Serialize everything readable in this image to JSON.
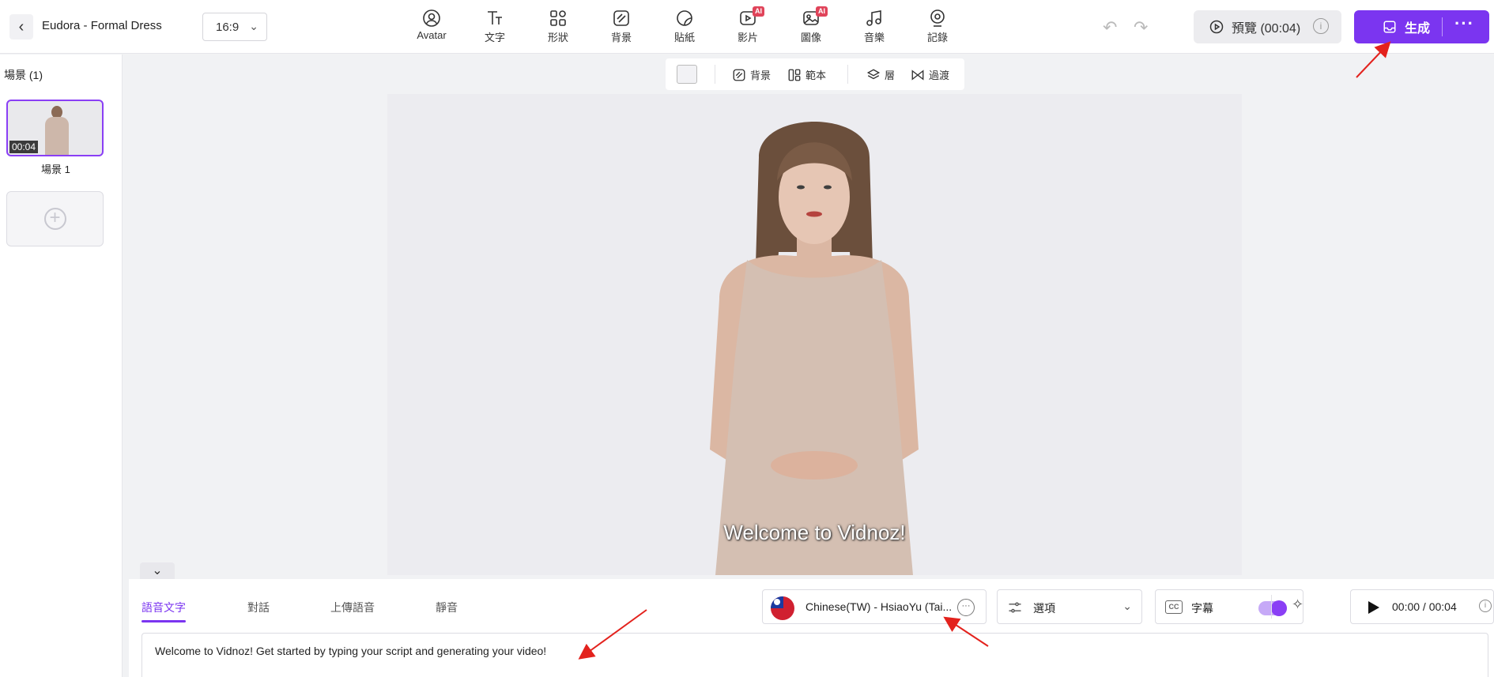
{
  "header": {
    "project_title": "Eudora - Formal Dress",
    "aspect_ratio": "16:9",
    "tools": [
      {
        "label": "Avatar",
        "icon": "avatar-icon",
        "ai": false
      },
      {
        "label": "文字",
        "icon": "text-icon",
        "ai": false
      },
      {
        "label": "形狀",
        "icon": "shapes-icon",
        "ai": false
      },
      {
        "label": "背景",
        "icon": "background-icon",
        "ai": false
      },
      {
        "label": "貼紙",
        "icon": "sticker-icon",
        "ai": false
      },
      {
        "label": "影片",
        "icon": "video-icon",
        "ai": true
      },
      {
        "label": "圖像",
        "icon": "image-icon",
        "ai": true
      },
      {
        "label": "音樂",
        "icon": "music-icon",
        "ai": false
      },
      {
        "label": "記錄",
        "icon": "record-icon",
        "ai": false
      }
    ],
    "ai_badge": "AI",
    "preview_label": "預覽 (00:04)",
    "generate_label": "生成",
    "accent_color": "#7b35f0"
  },
  "scenes": {
    "title": "場景 (1)",
    "items": [
      {
        "label": "場景 1",
        "duration": "00:04"
      }
    ]
  },
  "canvas_toolbar": {
    "background_label": "背景",
    "template_label": "範本",
    "layer_label": "層",
    "transition_label": "過渡"
  },
  "stage": {
    "subtitle": "Welcome to Vidnoz!"
  },
  "bottom": {
    "tabs": [
      "語音文字",
      "對話",
      "上傳語音",
      "靜音"
    ],
    "active_tab": 0,
    "voice": "Chinese(TW) - HsiaoYu (Tai...",
    "options_label": "選項",
    "captions_label": "字幕",
    "captions_on": true,
    "player_time": "00:00 / 00:04",
    "script_text": "Welcome to Vidnoz! Get started by typing your script and generating your video!"
  }
}
